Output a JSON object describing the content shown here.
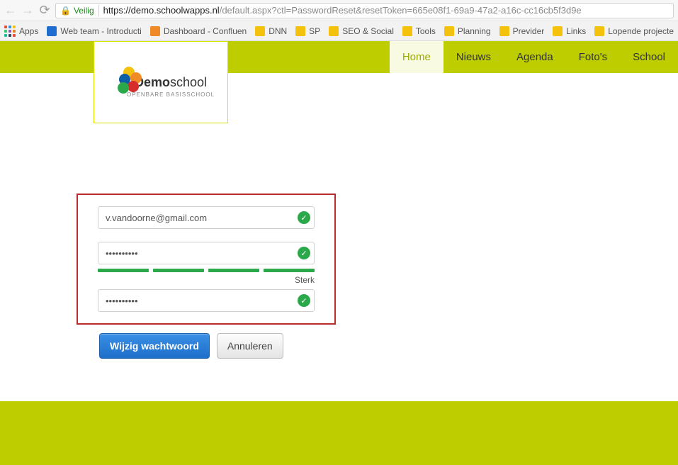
{
  "browser": {
    "secure_label": "Veilig",
    "url_prefix": "https://",
    "url_host": "demo.schoolwapps.nl",
    "url_path": "/default.aspx?ctl=PasswordReset&resetToken=665e08f1-69a9-47a2-a16c-cc16cb5f3d9e"
  },
  "bookmarks": {
    "apps": "Apps",
    "items": [
      "Web team - Introducti",
      "Dashboard - Confluen",
      "DNN",
      "SP",
      "SEO & Social",
      "Tools",
      "Planning",
      "Previder",
      "Links",
      "Lopende projecte"
    ]
  },
  "nav": {
    "items": [
      "Home",
      "Nieuws",
      "Agenda",
      "Foto's",
      "School"
    ],
    "active": 0
  },
  "logo": {
    "title_bold": "Demo",
    "title_thin": "school",
    "subtitle": "OPENBARE BASISSCHOOL"
  },
  "form": {
    "email": "v.vandoorne@gmail.com",
    "password1": "••••••••••",
    "password2": "••••••••••",
    "strength_label": "Sterk",
    "submit_label": "Wijzig wachtwoord",
    "cancel_label": "Annuleren"
  }
}
